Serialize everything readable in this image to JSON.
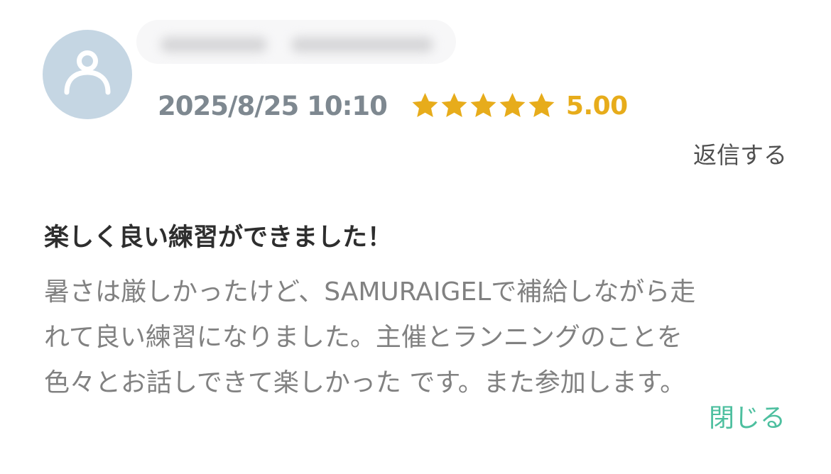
{
  "review": {
    "date": "2025/8/25 10:10",
    "rating_value": 5,
    "rating_text": "5.00",
    "star_color": "#e7ac1b",
    "reply_label": "返信する",
    "title": "楽しく良い練習ができました！",
    "body_lines": [
      "暑さは厳しかったけど、SAMURAIGELで補給しながら走",
      "れて良い練習になりました。主催とランニングのことを",
      "色々とお話しできて楽しかった です。また参加します。"
    ],
    "close_label": "閉じる",
    "avatar_icon": "user-icon"
  }
}
